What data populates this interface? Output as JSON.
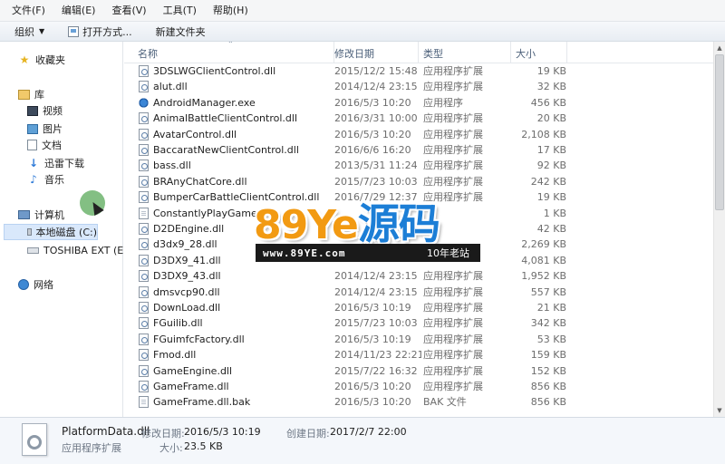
{
  "menubar": {
    "items": [
      "文件(F)",
      "编辑(E)",
      "查看(V)",
      "工具(T)",
      "帮助(H)"
    ]
  },
  "toolbar": {
    "organize": "组织",
    "open_with": "打开方式...",
    "new_folder": "新建文件夹"
  },
  "nav": {
    "favorites": "收藏夹",
    "libraries": "库",
    "videos": "视频",
    "pictures": "图片",
    "documents": "文档",
    "thunder_downloads": "迅雷下载",
    "music": "音乐",
    "computer": "计算机",
    "local_disk": "本地磁盘 (C:)",
    "external_drive": "TOSHIBA EXT (E:)",
    "network": "网络",
    "selected": "local_disk"
  },
  "columns": {
    "name": "名称",
    "date": "修改日期",
    "type": "类型",
    "size": "大小"
  },
  "files": [
    {
      "name": "3DSLWGClientControl.dll",
      "date": "2015/12/2 15:48",
      "type": "应用程序扩展",
      "size": "19 KB",
      "icon": "dll"
    },
    {
      "name": "alut.dll",
      "date": "2014/12/4 23:15",
      "type": "应用程序扩展",
      "size": "32 KB",
      "icon": "dll"
    },
    {
      "name": "AndroidManager.exe",
      "date": "2016/5/3 10:20",
      "type": "应用程序",
      "size": "456 KB",
      "icon": "app"
    },
    {
      "name": "AnimalBattleClientControl.dll",
      "date": "2016/3/31 10:00",
      "type": "应用程序扩展",
      "size": "20 KB",
      "icon": "dll"
    },
    {
      "name": "AvatarControl.dll",
      "date": "2016/5/3 10:20",
      "type": "应用程序扩展",
      "size": "2,108 KB",
      "icon": "dll"
    },
    {
      "name": "BaccaratNewClientControl.dll",
      "date": "2016/6/6 16:20",
      "type": "应用程序扩展",
      "size": "17 KB",
      "icon": "dll"
    },
    {
      "name": "bass.dll",
      "date": "2013/5/31 11:24",
      "type": "应用程序扩展",
      "size": "92 KB",
      "icon": "dll"
    },
    {
      "name": "BRAnyChatCore.dll",
      "date": "2015/7/23 10:03",
      "type": "应用程序扩展",
      "size": "242 KB",
      "icon": "dll"
    },
    {
      "name": "BumperCarBattleClientControl.dll",
      "date": "2016/7/29 12:37",
      "type": "应用程序扩展",
      "size": "19 KB",
      "icon": "dll"
    },
    {
      "name": "ConstantlyPlayGame.w",
      "date": "",
      "type": "",
      "size": "1 KB",
      "icon": "plain"
    },
    {
      "name": "D2DEngine.dll",
      "date": "",
      "type": "",
      "size": "42 KB",
      "icon": "dll"
    },
    {
      "name": "d3dx9_28.dll",
      "date": "",
      "type": "",
      "size": "2,269 KB",
      "icon": "dll"
    },
    {
      "name": "D3DX9_41.dll",
      "date": "",
      "type": "",
      "size": "4,081 KB",
      "icon": "dll"
    },
    {
      "name": "D3DX9_43.dll",
      "date": "2014/12/4 23:15",
      "type": "应用程序扩展",
      "size": "1,952 KB",
      "icon": "dll"
    },
    {
      "name": "dmsvcp90.dll",
      "date": "2014/12/4 23:15",
      "type": "应用程序扩展",
      "size": "557 KB",
      "icon": "dll"
    },
    {
      "name": "DownLoad.dll",
      "date": "2016/5/3 10:19",
      "type": "应用程序扩展",
      "size": "21 KB",
      "icon": "dll"
    },
    {
      "name": "FGuilib.dll",
      "date": "2015/7/23 10:03",
      "type": "应用程序扩展",
      "size": "342 KB",
      "icon": "dll"
    },
    {
      "name": "FGuimfcFactory.dll",
      "date": "2016/5/3 10:19",
      "type": "应用程序扩展",
      "size": "53 KB",
      "icon": "dll"
    },
    {
      "name": "Fmod.dll",
      "date": "2014/11/23 22:21",
      "type": "应用程序扩展",
      "size": "159 KB",
      "icon": "dll"
    },
    {
      "name": "GameEngine.dll",
      "date": "2015/7/22 16:32",
      "type": "应用程序扩展",
      "size": "152 KB",
      "icon": "dll"
    },
    {
      "name": "GameFrame.dll",
      "date": "2016/5/3 10:20",
      "type": "应用程序扩展",
      "size": "856 KB",
      "icon": "dll"
    },
    {
      "name": "GameFrame.dll.bak",
      "date": "2016/5/3 10:20",
      "type": "BAK 文件",
      "size": "856 KB",
      "icon": "plain"
    }
  ],
  "watermark": {
    "brand": "89Ye",
    "brand_zh": "源码",
    "url": "www.89YE.com",
    "tagline": "10年老站"
  },
  "details": {
    "filename": "PlatformData.dll",
    "filetype": "应用程序扩展",
    "modified_label": "修改日期:",
    "modified_value": "2016/5/3 10:19",
    "created_label": "创建日期:",
    "created_value": "2017/2/7 22:00",
    "size_label": "大小:",
    "size_value": "23.5 KB"
  }
}
